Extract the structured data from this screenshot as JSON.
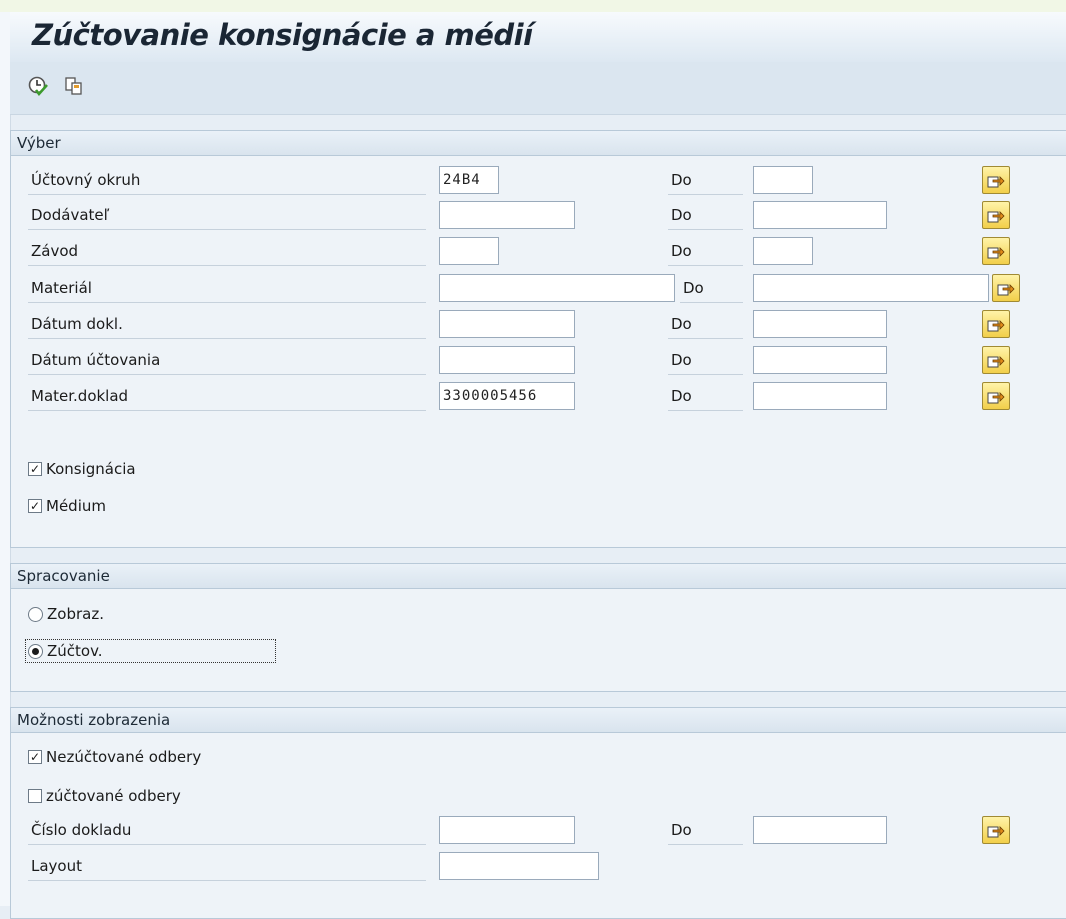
{
  "title": "Zúčtovanie konsignácie a médií",
  "toolbar": {
    "execute_icon": "execute-clock-icon",
    "copy_icon": "get-variant-icon"
  },
  "selection": {
    "header": "Výber",
    "do_label": "Do",
    "rows": [
      {
        "label": "Účtovný okruh",
        "from": "24B4",
        "to": ""
      },
      {
        "label": "Dodávateľ",
        "from": "",
        "to": ""
      },
      {
        "label": "Závod",
        "from": "",
        "to": ""
      },
      {
        "label": "Materiál",
        "from": "",
        "to": ""
      },
      {
        "label": "Dátum dokl.",
        "from": "",
        "to": ""
      },
      {
        "label": "Dátum účtovania",
        "from": "",
        "to": ""
      },
      {
        "label": "Mater.doklad",
        "from": "3300005456",
        "to": ""
      }
    ],
    "checkboxes": [
      {
        "label": "Konsignácia",
        "checked": true
      },
      {
        "label": "Médium",
        "checked": true
      }
    ]
  },
  "processing": {
    "header": "Spracovanie",
    "radios": [
      {
        "label": "Zobraz.",
        "selected": false
      },
      {
        "label": "Zúčtov.",
        "selected": true
      }
    ]
  },
  "display": {
    "header": "Možnosti zobrazenia",
    "checkboxes": [
      {
        "label": "Nezúčtované odbery",
        "checked": true
      },
      {
        "label": "zúčtované odbery",
        "checked": false
      }
    ],
    "doc_number": {
      "label": "Číslo dokladu",
      "from": "",
      "to": ""
    },
    "layout": {
      "label": "Layout",
      "value": ""
    }
  },
  "colors": {
    "background": "#e7eef5",
    "button_yellow": "#f2cf4a"
  }
}
